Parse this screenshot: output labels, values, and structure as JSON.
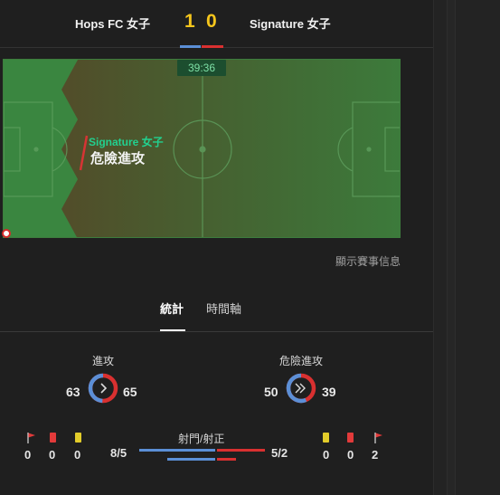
{
  "match": {
    "home_team": "Hops FC 女子",
    "away_team": "Signature 女子",
    "home_score": "1",
    "away_score": "0"
  },
  "pitch": {
    "clock": "39:36",
    "event_team": "Signature 女子",
    "event_type": "危險進攻",
    "show_info_link": "顯示賽事信息"
  },
  "tabs": [
    {
      "label": "統計",
      "active": true
    },
    {
      "label": "時間軸",
      "active": false
    }
  ],
  "stats": {
    "attacks": {
      "label": "進攻",
      "home": "63",
      "away": "65",
      "home_value": 63,
      "away_value": 65
    },
    "dangerous_attacks": {
      "label": "危險進攻",
      "home": "50",
      "away": "39",
      "home_value": 50,
      "away_value": 39
    },
    "shots": {
      "label": "射門/射正",
      "home": "8/5",
      "away": "5/2",
      "home_total": 8,
      "home_on": 5,
      "away_total": 5,
      "away_on": 2
    },
    "home_cards": {
      "corners": "0",
      "red": "0",
      "yellow": "0"
    },
    "away_cards": {
      "yellow": "0",
      "red": "0",
      "corners": "2"
    }
  },
  "colors": {
    "home": "#5b8fd6",
    "away": "#d93030",
    "score": "#f6c61c",
    "event_team": "#22d08f",
    "pitch": "#3e8a43"
  },
  "icons": {
    "corner": "corner-flag-icon",
    "red_card": "red-card-icon",
    "yellow_card": "yellow-card-icon",
    "attack": "chevron-right-icon",
    "dangerous_attack": "double-chevron-right-icon"
  }
}
